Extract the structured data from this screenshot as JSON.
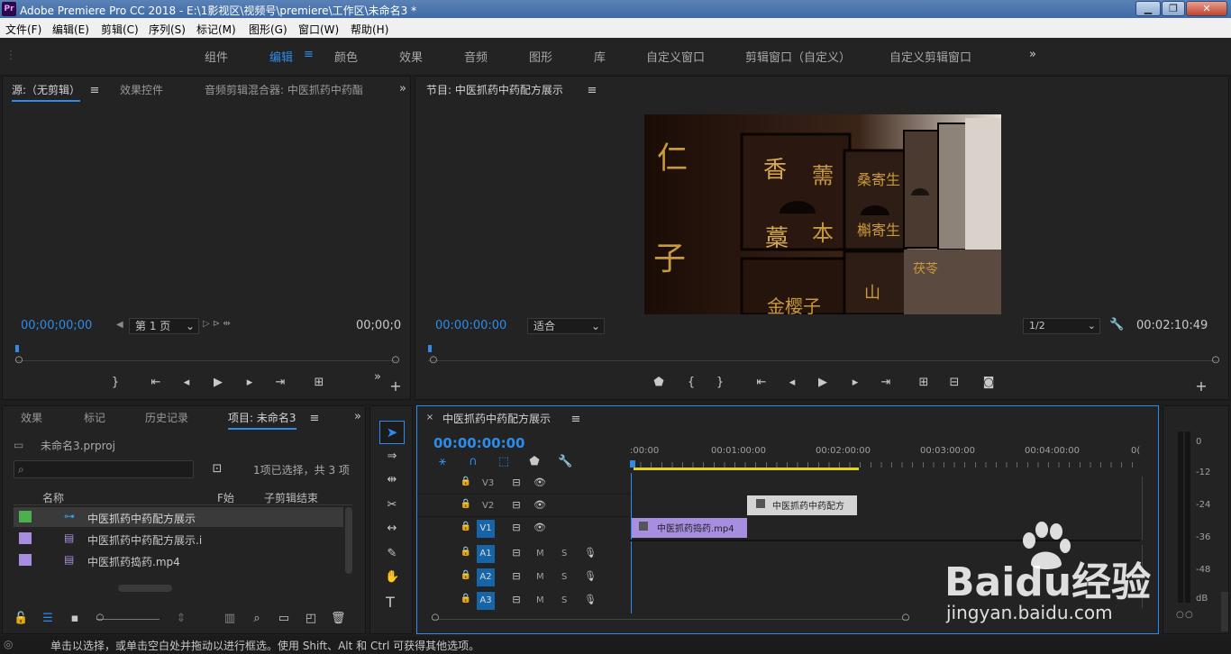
{
  "window": {
    "title": "Adobe Premiere Pro CC 2018 - E:\\1影视区\\视频号\\premiere\\工作区\\未命名3 *",
    "logo": "Pr"
  },
  "menu": [
    "文件(F)",
    "编辑(E)",
    "剪辑(C)",
    "序列(S)",
    "标记(M)",
    "图形(G)",
    "窗口(W)",
    "帮助(H)"
  ],
  "workspaces": [
    "组件",
    "编辑",
    "颜色",
    "效果",
    "音频",
    "图形",
    "库",
    "自定义窗口",
    "剪辑窗口（自定义）",
    "自定义剪辑窗口"
  ],
  "source_panel": {
    "tabs": [
      "源:（无剪辑）",
      "效果控件",
      "音频剪辑混合器: 中医抓药中药酯"
    ],
    "timecode_left": "00;00;00;00",
    "timecode_right": "00;00;0",
    "page": "第 1 页"
  },
  "program_panel": {
    "title": "节目: 中医抓药中药配方展示",
    "timecode_left": "00:00:00:00",
    "fit": "适合",
    "quality": "1/2",
    "timecode_right": "00:02:10:49"
  },
  "project_panel": {
    "tabs": [
      "效果",
      "标记",
      "历史记录",
      "项目: 未命名3"
    ],
    "project_file": "未命名3.prproj",
    "selection_info": "1项已选择，共 3 项",
    "columns": [
      "名称",
      "F始",
      "子剪辑结束"
    ],
    "items": [
      {
        "name": "中医抓药中药配方展示",
        "color": "#4caf50",
        "type": "sequence"
      },
      {
        "name": "中医抓药中药配方展示.i",
        "color": "#a78ee0",
        "type": "clip"
      },
      {
        "name": "中医抓药捣药.mp4",
        "color": "#a78ee0",
        "type": "clip"
      }
    ]
  },
  "timeline": {
    "title": "中医抓药中药配方展示",
    "timecode": "00:00:00:00",
    "ruler": [
      ":00:00",
      "00:01:00:00",
      "00:02:00:00",
      "00:03:00:00",
      "00:04:00:00",
      "0("
    ],
    "video_tracks": [
      "V3",
      "V2",
      "V1"
    ],
    "audio_tracks": [
      "A1",
      "A2",
      "A3"
    ],
    "clips": [
      {
        "track": "V2",
        "label": "中医抓药中药配方"
      },
      {
        "track": "V1",
        "label": "中医抓药捣药.mp4"
      }
    ],
    "m_label": "M",
    "s_label": "S"
  },
  "meter": {
    "scale": [
      "0",
      "-12",
      "-24",
      "-36",
      "-48",
      "dB"
    ]
  },
  "preview": {
    "characters": [
      "仁",
      "香",
      "薷",
      "桑寄生",
      "藁",
      "本",
      "槲寄生",
      "子",
      "山",
      "金樱子",
      "茯苓"
    ]
  },
  "status": "单击以选择，或单击空白处并拖动以进行框选。使用 Shift、Alt 和 Ctrl 可获得其他选项。",
  "watermark": {
    "brand": "Baidu经验",
    "url": "jingyan.baidu.com"
  },
  "colors": {
    "accent": "#2d8ceb",
    "v1_clip": "#a78ee0",
    "v2_clip": "#c8c8c8",
    "work_area": "#e6d21a"
  }
}
